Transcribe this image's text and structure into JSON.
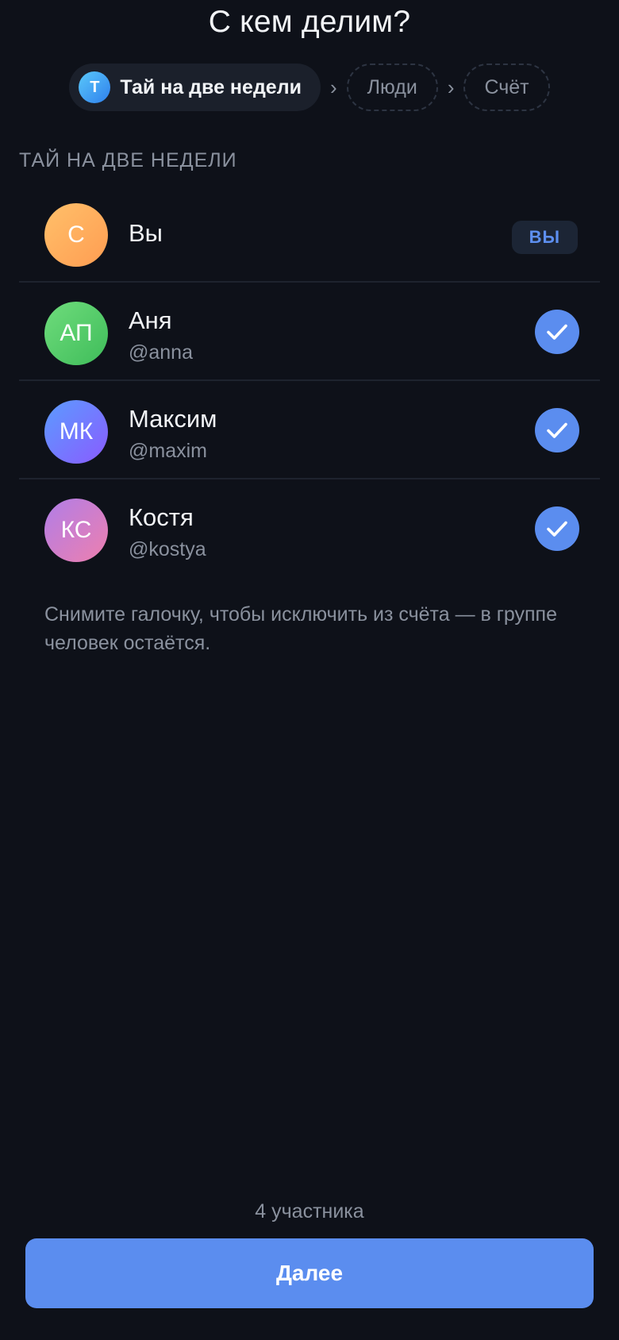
{
  "page": {
    "title": "С кем делим?"
  },
  "steps": {
    "active": {
      "avatar_letter": "Т",
      "label": "Тай на две недели"
    },
    "separator": "›",
    "pending": [
      "Люди",
      "Счёт"
    ]
  },
  "section": {
    "label": "ТАЙ НА ДВЕ НЕДЕЛИ"
  },
  "members": [
    {
      "initials": "С",
      "name": "Вы",
      "handle": "",
      "badge": "ВЫ",
      "checked": null,
      "gradient": [
        "#ffc06a",
        "#ff9d52"
      ]
    },
    {
      "initials": "АП",
      "name": "Аня",
      "handle": "@anna",
      "badge": "",
      "checked": true,
      "gradient": [
        "#6fdc7c",
        "#3fbd5a"
      ]
    },
    {
      "initials": "МК",
      "name": "Максим",
      "handle": "@maxim",
      "badge": "",
      "checked": true,
      "gradient": [
        "#5b9cff",
        "#8a5bff"
      ]
    },
    {
      "initials": "КС",
      "name": "Костя",
      "handle": "@kostya",
      "badge": "",
      "checked": true,
      "gradient": [
        "#b07ee8",
        "#ee7fae"
      ]
    }
  ],
  "hint": "Снимите галочку, чтобы исключить из счёта — в группе человек остаётся.",
  "footer": {
    "count": "4 участника",
    "next_label": "Далее"
  },
  "colors": {
    "background": "#0e1119",
    "accent": "#5b8def",
    "muted": "#8a919e"
  },
  "icons": {
    "check": "check-icon"
  }
}
